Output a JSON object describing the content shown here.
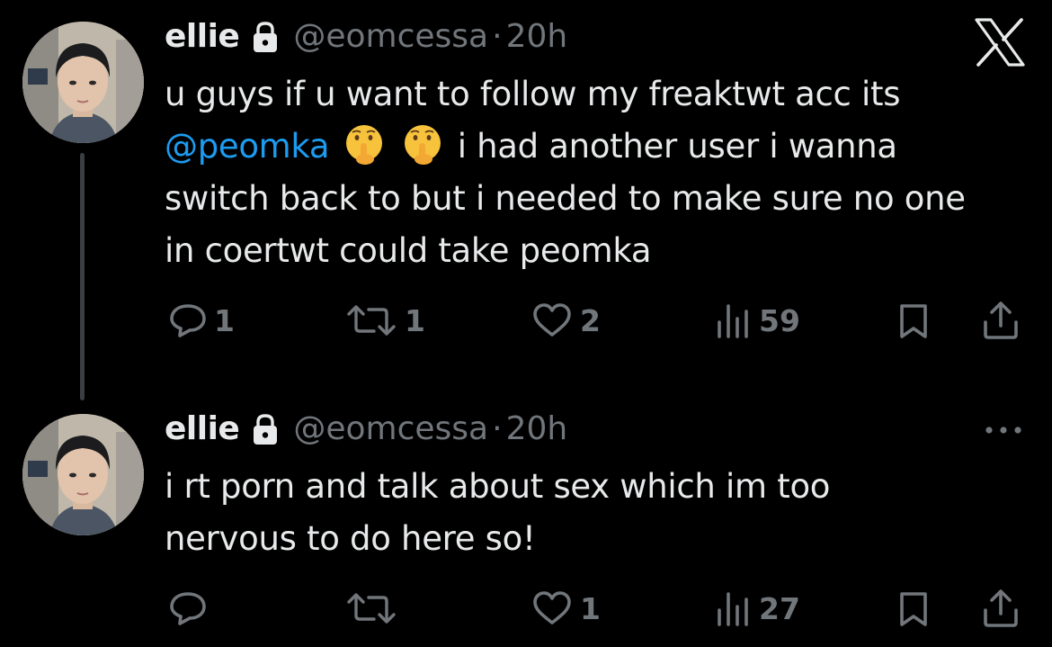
{
  "tweets": [
    {
      "display_name": "ellie",
      "handle": "@eomcessa",
      "separator": "·",
      "time": "20h",
      "text_before": "u guys if u want to follow my freaktwt acc its",
      "mention": "@peomka",
      "emoji": "shushing-face",
      "text_after": "i had another user i wanna switch back to but i needed to make sure no one in coertwt could take peomka",
      "replies": "1",
      "retweets": "1",
      "likes": "2",
      "views": "59"
    },
    {
      "display_name": "ellie",
      "handle": "@eomcessa",
      "separator": "·",
      "time": "20h",
      "text": "i rt porn and talk about sex which im too nervous to do here so!",
      "replies": "",
      "retweets": "",
      "likes": "1",
      "views": "27"
    }
  ],
  "icons": {
    "close": "x-logo-icon",
    "more": "more-options-icon",
    "lock": "lock-icon",
    "reply": "reply-icon",
    "retweet": "retweet-icon",
    "like": "heart-icon",
    "views": "views-icon",
    "bookmark": "bookmark-icon",
    "share": "share-icon"
  },
  "colors": {
    "background": "#000000",
    "text": "#e7e9ea",
    "secondary": "#71767b",
    "mention": "#1d9bf0",
    "thread_line": "#3a3d41"
  }
}
